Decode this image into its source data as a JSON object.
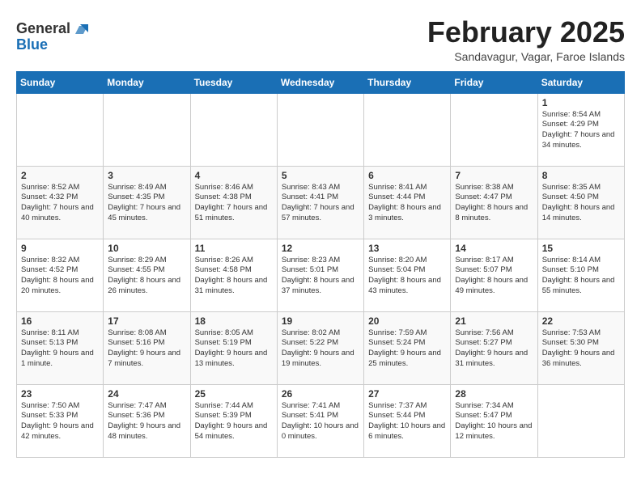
{
  "header": {
    "logo_general": "General",
    "logo_blue": "Blue",
    "title": "February 2025",
    "subtitle": "Sandavagur, Vagar, Faroe Islands"
  },
  "weekdays": [
    "Sunday",
    "Monday",
    "Tuesday",
    "Wednesday",
    "Thursday",
    "Friday",
    "Saturday"
  ],
  "rows": [
    [
      {
        "day": "",
        "info": ""
      },
      {
        "day": "",
        "info": ""
      },
      {
        "day": "",
        "info": ""
      },
      {
        "day": "",
        "info": ""
      },
      {
        "day": "",
        "info": ""
      },
      {
        "day": "",
        "info": ""
      },
      {
        "day": "1",
        "info": "Sunrise: 8:54 AM\nSunset: 4:29 PM\nDaylight: 7 hours\nand 34 minutes."
      }
    ],
    [
      {
        "day": "2",
        "info": "Sunrise: 8:52 AM\nSunset: 4:32 PM\nDaylight: 7 hours\nand 40 minutes."
      },
      {
        "day": "3",
        "info": "Sunrise: 8:49 AM\nSunset: 4:35 PM\nDaylight: 7 hours\nand 45 minutes."
      },
      {
        "day": "4",
        "info": "Sunrise: 8:46 AM\nSunset: 4:38 PM\nDaylight: 7 hours\nand 51 minutes."
      },
      {
        "day": "5",
        "info": "Sunrise: 8:43 AM\nSunset: 4:41 PM\nDaylight: 7 hours\nand 57 minutes."
      },
      {
        "day": "6",
        "info": "Sunrise: 8:41 AM\nSunset: 4:44 PM\nDaylight: 8 hours\nand 3 minutes."
      },
      {
        "day": "7",
        "info": "Sunrise: 8:38 AM\nSunset: 4:47 PM\nDaylight: 8 hours\nand 8 minutes."
      },
      {
        "day": "8",
        "info": "Sunrise: 8:35 AM\nSunset: 4:50 PM\nDaylight: 8 hours\nand 14 minutes."
      }
    ],
    [
      {
        "day": "9",
        "info": "Sunrise: 8:32 AM\nSunset: 4:52 PM\nDaylight: 8 hours\nand 20 minutes."
      },
      {
        "day": "10",
        "info": "Sunrise: 8:29 AM\nSunset: 4:55 PM\nDaylight: 8 hours\nand 26 minutes."
      },
      {
        "day": "11",
        "info": "Sunrise: 8:26 AM\nSunset: 4:58 PM\nDaylight: 8 hours\nand 31 minutes."
      },
      {
        "day": "12",
        "info": "Sunrise: 8:23 AM\nSunset: 5:01 PM\nDaylight: 8 hours\nand 37 minutes."
      },
      {
        "day": "13",
        "info": "Sunrise: 8:20 AM\nSunset: 5:04 PM\nDaylight: 8 hours\nand 43 minutes."
      },
      {
        "day": "14",
        "info": "Sunrise: 8:17 AM\nSunset: 5:07 PM\nDaylight: 8 hours\nand 49 minutes."
      },
      {
        "day": "15",
        "info": "Sunrise: 8:14 AM\nSunset: 5:10 PM\nDaylight: 8 hours\nand 55 minutes."
      }
    ],
    [
      {
        "day": "16",
        "info": "Sunrise: 8:11 AM\nSunset: 5:13 PM\nDaylight: 9 hours\nand 1 minute."
      },
      {
        "day": "17",
        "info": "Sunrise: 8:08 AM\nSunset: 5:16 PM\nDaylight: 9 hours\nand 7 minutes."
      },
      {
        "day": "18",
        "info": "Sunrise: 8:05 AM\nSunset: 5:19 PM\nDaylight: 9 hours\nand 13 minutes."
      },
      {
        "day": "19",
        "info": "Sunrise: 8:02 AM\nSunset: 5:22 PM\nDaylight: 9 hours\nand 19 minutes."
      },
      {
        "day": "20",
        "info": "Sunrise: 7:59 AM\nSunset: 5:24 PM\nDaylight: 9 hours\nand 25 minutes."
      },
      {
        "day": "21",
        "info": "Sunrise: 7:56 AM\nSunset: 5:27 PM\nDaylight: 9 hours\nand 31 minutes."
      },
      {
        "day": "22",
        "info": "Sunrise: 7:53 AM\nSunset: 5:30 PM\nDaylight: 9 hours\nand 36 minutes."
      }
    ],
    [
      {
        "day": "23",
        "info": "Sunrise: 7:50 AM\nSunset: 5:33 PM\nDaylight: 9 hours\nand 42 minutes."
      },
      {
        "day": "24",
        "info": "Sunrise: 7:47 AM\nSunset: 5:36 PM\nDaylight: 9 hours\nand 48 minutes."
      },
      {
        "day": "25",
        "info": "Sunrise: 7:44 AM\nSunset: 5:39 PM\nDaylight: 9 hours\nand 54 minutes."
      },
      {
        "day": "26",
        "info": "Sunrise: 7:41 AM\nSunset: 5:41 PM\nDaylight: 10 hours\nand 0 minutes."
      },
      {
        "day": "27",
        "info": "Sunrise: 7:37 AM\nSunset: 5:44 PM\nDaylight: 10 hours\nand 6 minutes."
      },
      {
        "day": "28",
        "info": "Sunrise: 7:34 AM\nSunset: 5:47 PM\nDaylight: 10 hours\nand 12 minutes."
      },
      {
        "day": "",
        "info": ""
      }
    ]
  ]
}
